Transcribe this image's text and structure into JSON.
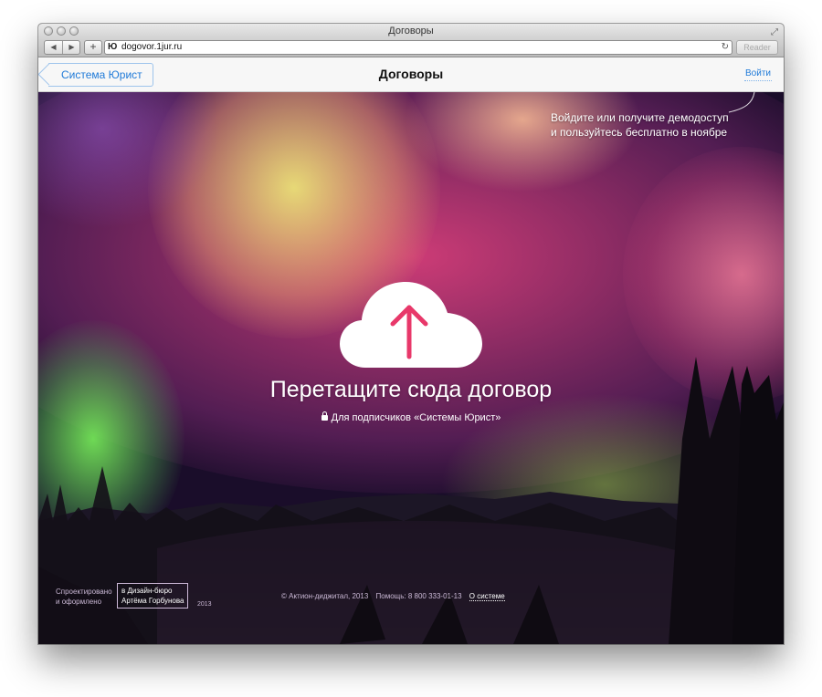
{
  "browser": {
    "window_title": "Договоры",
    "url": "dogovor.1jur.ru",
    "favicon": "Ю",
    "reader_label": "Reader"
  },
  "page_nav": {
    "back_label": "Система Юрист",
    "title": "Договоры",
    "login_label": "Войти"
  },
  "hero": {
    "tip_line1": "Войдите или получите демодоступ",
    "tip_line2": "и пользуйтесь бесплатно в ноябре",
    "headline": "Перетащите сюда договор",
    "subscribers_note": "Для подписчиков «Системы Юрист»",
    "upload_icon": "cloud-upload-icon",
    "accent_color": "#e8386a"
  },
  "credits": {
    "designed_line1": "Спроектировано",
    "designed_line2": "и оформлено",
    "studio_line1": "в Дизайн-бюро",
    "studio_line2": "Артёма Горбунова",
    "year": "2013"
  },
  "footer": {
    "copyright": "© Актион-диджитал, 2013",
    "help": "Помощь: 8 800 333-01-13",
    "about_link": "О системе"
  }
}
